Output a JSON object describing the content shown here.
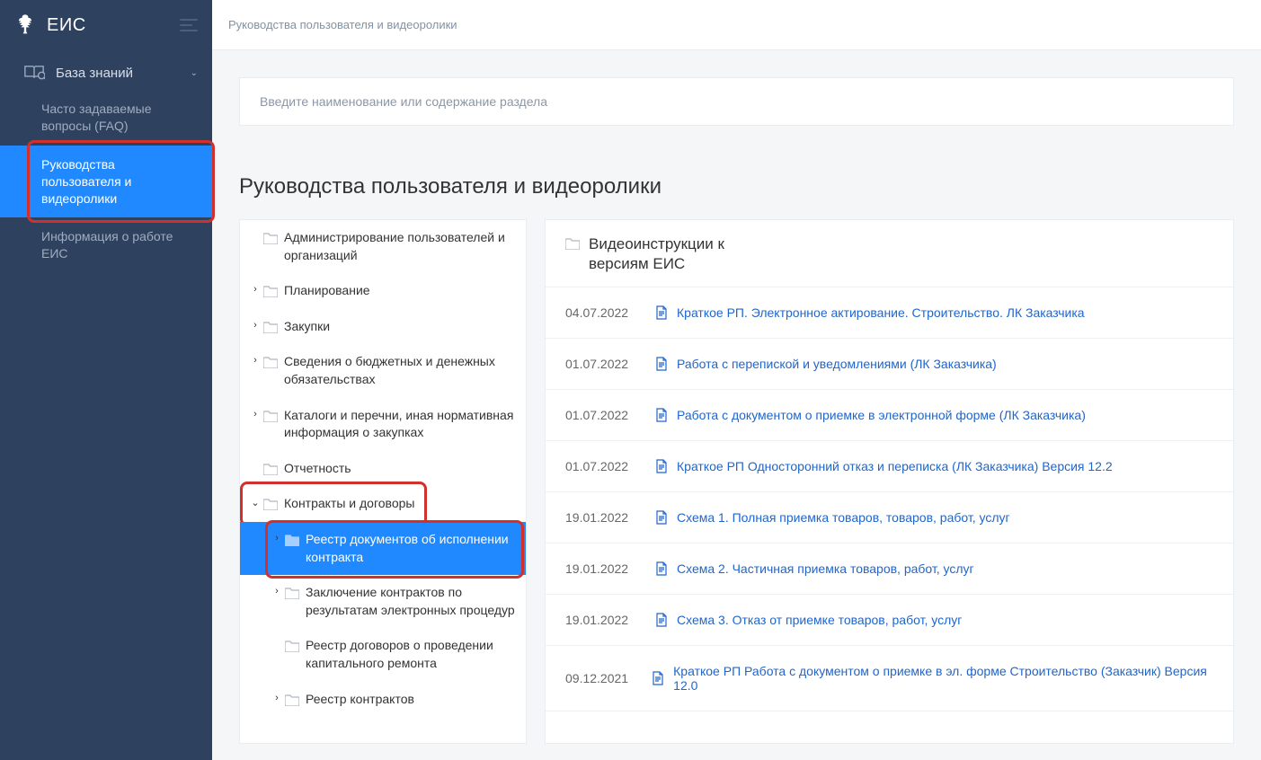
{
  "brand": "ЕИС",
  "breadcrumb": "Руководства пользователя и видеоролики",
  "sidebar": {
    "section": "База знаний",
    "items": [
      {
        "label": "Часто задаваемые вопросы (FAQ)"
      },
      {
        "label": "Руководства пользователя и видеоролики"
      },
      {
        "label": "Информация о работе ЕИС"
      }
    ]
  },
  "search_placeholder": "Введите наименование или содержание раздела",
  "page_title": "Руководства пользователя и видеоролики",
  "tree": [
    {
      "label": "Администрирование пользователей и организаций",
      "level": 1,
      "arrow": false
    },
    {
      "label": "Планирование",
      "level": 1,
      "arrow": true
    },
    {
      "label": "Закупки",
      "level": 1,
      "arrow": true
    },
    {
      "label": "Сведения о бюджетных и денежных обязательствах",
      "level": 1,
      "arrow": true
    },
    {
      "label": "Каталоги и перечни, иная нормативная информация о закупках",
      "level": 1,
      "arrow": true
    },
    {
      "label": "Отчетность",
      "level": 1,
      "arrow": false
    },
    {
      "label": "Контракты и договоры",
      "level": 1,
      "arrow": true,
      "expanded": true,
      "highlight": 1
    },
    {
      "label": "Реестр документов об исполнении контракта",
      "level": 2,
      "arrow": true,
      "selected": true,
      "highlight": 2
    },
    {
      "label": "Заключение контрактов по результатам электронных процедур",
      "level": 2,
      "arrow": true
    },
    {
      "label": "Реестр договоров о проведении капитального ремонта",
      "level": 2,
      "arrow": false
    },
    {
      "label": "Реестр контрактов",
      "level": 2,
      "arrow": true
    }
  ],
  "docs_header": "Видеоинструкции к версиям ЕИС",
  "docs": [
    {
      "date": "04.07.2022",
      "title": "Краткое РП. Электронное актирование. Строительство. ЛК Заказчика"
    },
    {
      "date": "01.07.2022",
      "title": "Работа с перепиской и уведомлениями (ЛК Заказчика)"
    },
    {
      "date": "01.07.2022",
      "title": "Работа с документом о приемке в электронной форме (ЛК Заказчика)"
    },
    {
      "date": "01.07.2022",
      "title": "Краткое РП Односторонний отказ и переписка (ЛК Заказчика) Версия 12.2"
    },
    {
      "date": "19.01.2022",
      "title": "Схема 1. Полная приемка товаров, товаров, работ, услуг"
    },
    {
      "date": "19.01.2022",
      "title": "Схема 2. Частичная приемка товаров, работ, услуг"
    },
    {
      "date": "19.01.2022",
      "title": "Схема 3. Отказ от приемке товаров, работ, услуг"
    },
    {
      "date": "09.12.2021",
      "title": "Краткое РП Работа с документом о приемке в эл. форме Строительство (Заказчик) Версия 12.0"
    }
  ]
}
